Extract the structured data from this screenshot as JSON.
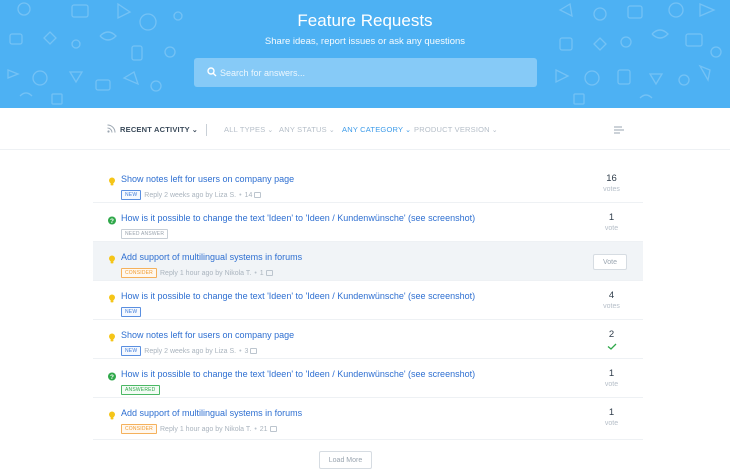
{
  "header": {
    "title": "Feature Requests",
    "subtitle": "Share ideas, report issues or ask any questions",
    "search_placeholder": "Search for answers...",
    "background_color": "#4db1f3"
  },
  "filters": {
    "recent_activity": "RECENT ACTIVITY",
    "all_types": "ALL TYPES",
    "any_status": "ANY STATUS",
    "any_category": "ANY CATEGORY",
    "product_version": "PRODUCT VERSION"
  },
  "items": [
    {
      "icon": "lightbulb-icon",
      "title": "Show notes left for users on company page",
      "badge": "NEW",
      "badge_type": "new",
      "meta": "Reply 2 weeks ago by Liza S.",
      "comments": "14",
      "votes": "16",
      "vote_label": "votes"
    },
    {
      "icon": "question-icon",
      "title": "How is it possible to change the text 'Ideen' to 'Ideen / Kundenwünsche' (see screenshot)",
      "badge": "NEED ANSWER",
      "badge_type": "need",
      "meta": "",
      "comments": "",
      "votes": "1",
      "vote_label": "vote"
    },
    {
      "icon": "lightbulb-icon",
      "title": "Add support of multilingual systems in forums",
      "badge": "CONSIDER",
      "badge_type": "consider",
      "meta": "Reply 1 hour ago by Nikola T.",
      "comments": "1",
      "vote_button": "Vote",
      "highlighted": true
    },
    {
      "icon": "lightbulb-icon",
      "title": "How is it possible to change the text 'Ideen' to 'Ideen / Kundenwünsche' (see screenshot)",
      "badge": "NEW",
      "badge_type": "new",
      "meta": "",
      "comments": "",
      "votes": "4",
      "vote_label": "votes"
    },
    {
      "icon": "lightbulb-icon",
      "title": "Show notes left for users on company page",
      "badge": "NEW",
      "badge_type": "new",
      "meta": "Reply 2 weeks ago by Liza S.",
      "comments": "3",
      "votes": "2",
      "voted": true
    },
    {
      "icon": "question-icon",
      "title": "How is it possible to change the text 'Ideen' to 'Ideen / Kundenwünsche' (see screenshot)",
      "badge": "ANSWERED",
      "badge_type": "answered",
      "meta": "",
      "comments": "",
      "votes": "1",
      "vote_label": "vote"
    },
    {
      "icon": "lightbulb-icon",
      "title": "Add support of multilingual systems in forums",
      "badge": "CONSIDER",
      "badge_type": "consider",
      "meta": "Reply 1 hour ago by Nikola T.",
      "comments": "21",
      "votes": "1",
      "vote_label": "vote"
    }
  ],
  "load_more": "Load More",
  "colors": {
    "accent": "#3d9be9",
    "link": "#2e6fd1",
    "idea": "#f5c518",
    "answered": "#2fa84a"
  }
}
